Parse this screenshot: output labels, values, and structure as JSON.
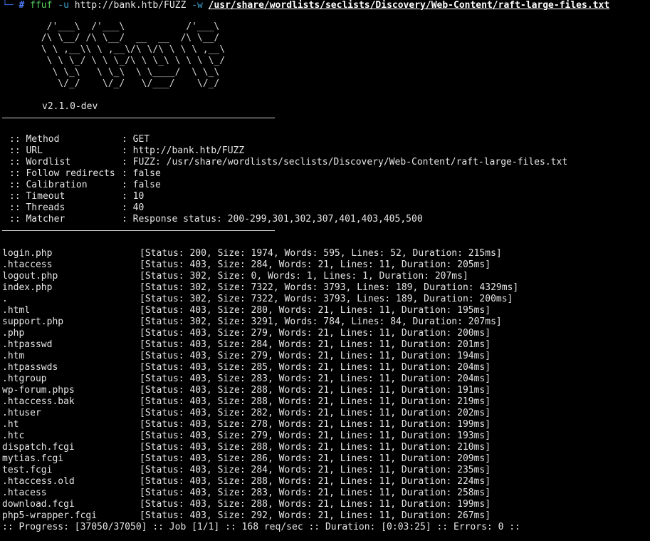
{
  "prompt": {
    "corner": "└─",
    "hash": "#",
    "command": "ffuf",
    "flag_u": "-u",
    "url": "http://bank.htb/FUZZ",
    "flag_w": "-w",
    "wordlist_path": "/usr/share/wordlists/seclists/Discovery/Web-Content/raft-large-files.txt"
  },
  "banner": {
    "art": [
      "        /'___\\  /'___\\           /'___\\",
      "       /\\ \\__/ /\\ \\__/  __  __  /\\ \\__/",
      "       \\ \\ ,__\\\\ \\ ,__\\/\\ \\/\\ \\ \\ \\ ,__\\",
      "        \\ \\ \\_/ \\ \\ \\_/\\ \\ \\_\\ \\ \\ \\ \\_/",
      "         \\ \\_\\   \\ \\_\\  \\ \\____/  \\ \\_\\",
      "          \\/_/    \\/_/   \\/___/    \\/_/"
    ],
    "version": "v2.1.0-dev"
  },
  "config": [
    {
      "key": ":: Method",
      "value": ": GET"
    },
    {
      "key": ":: URL",
      "value": ": http://bank.htb/FUZZ"
    },
    {
      "key": ":: Wordlist",
      "value": ": FUZZ: /usr/share/wordlists/seclists/Discovery/Web-Content/raft-large-files.txt"
    },
    {
      "key": ":: Follow redirects",
      "value": ": false"
    },
    {
      "key": ":: Calibration",
      "value": ": false"
    },
    {
      "key": ":: Timeout",
      "value": ": 10"
    },
    {
      "key": ":: Threads",
      "value": ": 40"
    },
    {
      "key": ":: Matcher",
      "value": ": Response status: 200-299,301,302,307,401,403,405,500"
    }
  ],
  "results": [
    {
      "name": "login.php",
      "status": "[Status: 200, Size: 1974, Words: 595, Lines: 52, Duration: 215ms]"
    },
    {
      "name": ".htaccess",
      "status": "[Status: 403, Size: 284, Words: 21, Lines: 11, Duration: 205ms]"
    },
    {
      "name": "logout.php",
      "status": "[Status: 302, Size: 0, Words: 1, Lines: 1, Duration: 207ms]"
    },
    {
      "name": "index.php",
      "status": "[Status: 302, Size: 7322, Words: 3793, Lines: 189, Duration: 4329ms]"
    },
    {
      "name": ".",
      "status": "[Status: 302, Size: 7322, Words: 3793, Lines: 189, Duration: 200ms]"
    },
    {
      "name": ".html",
      "status": "[Status: 403, Size: 280, Words: 21, Lines: 11, Duration: 195ms]"
    },
    {
      "name": "support.php",
      "status": "[Status: 302, Size: 3291, Words: 784, Lines: 84, Duration: 207ms]"
    },
    {
      "name": ".php",
      "status": "[Status: 403, Size: 279, Words: 21, Lines: 11, Duration: 200ms]"
    },
    {
      "name": ".htpasswd",
      "status": "[Status: 403, Size: 284, Words: 21, Lines: 11, Duration: 201ms]"
    },
    {
      "name": ".htm",
      "status": "[Status: 403, Size: 279, Words: 21, Lines: 11, Duration: 194ms]"
    },
    {
      "name": ".htpasswds",
      "status": "[Status: 403, Size: 285, Words: 21, Lines: 11, Duration: 204ms]"
    },
    {
      "name": ".htgroup",
      "status": "[Status: 403, Size: 283, Words: 21, Lines: 11, Duration: 204ms]"
    },
    {
      "name": "wp-forum.phps",
      "status": "[Status: 403, Size: 288, Words: 21, Lines: 11, Duration: 191ms]"
    },
    {
      "name": ".htaccess.bak",
      "status": "[Status: 403, Size: 288, Words: 21, Lines: 11, Duration: 219ms]"
    },
    {
      "name": ".htuser",
      "status": "[Status: 403, Size: 282, Words: 21, Lines: 11, Duration: 202ms]"
    },
    {
      "name": ".ht",
      "status": "[Status: 403, Size: 278, Words: 21, Lines: 11, Duration: 199ms]"
    },
    {
      "name": ".htc",
      "status": "[Status: 403, Size: 279, Words: 21, Lines: 11, Duration: 193ms]"
    },
    {
      "name": "dispatch.fcgi",
      "status": "[Status: 403, Size: 288, Words: 21, Lines: 11, Duration: 210ms]"
    },
    {
      "name": "mytias.fcgi",
      "status": "[Status: 403, Size: 286, Words: 21, Lines: 11, Duration: 209ms]"
    },
    {
      "name": "test.fcgi",
      "status": "[Status: 403, Size: 284, Words: 21, Lines: 11, Duration: 235ms]"
    },
    {
      "name": ".htaccess.old",
      "status": "[Status: 403, Size: 288, Words: 21, Lines: 11, Duration: 224ms]"
    },
    {
      "name": ".htacess",
      "status": "[Status: 403, Size: 283, Words: 21, Lines: 11, Duration: 258ms]"
    },
    {
      "name": "download.fcgi",
      "status": "[Status: 403, Size: 288, Words: 21, Lines: 11, Duration: 199ms]"
    },
    {
      "name": "php5-wrapper.fcgi",
      "status": "[Status: 403, Size: 292, Words: 21, Lines: 11, Duration: 267ms]"
    }
  ],
  "progress": ":: Progress: [37050/37050] :: Job [1/1] :: 168 req/sec :: Duration: [0:03:25] :: Errors: 0 ::",
  "colors": {
    "background": "#000000",
    "text": "#e6e6e6",
    "prompt": "#4d7fff",
    "command": "#54ce5c",
    "flag": "#3aa0c9"
  }
}
